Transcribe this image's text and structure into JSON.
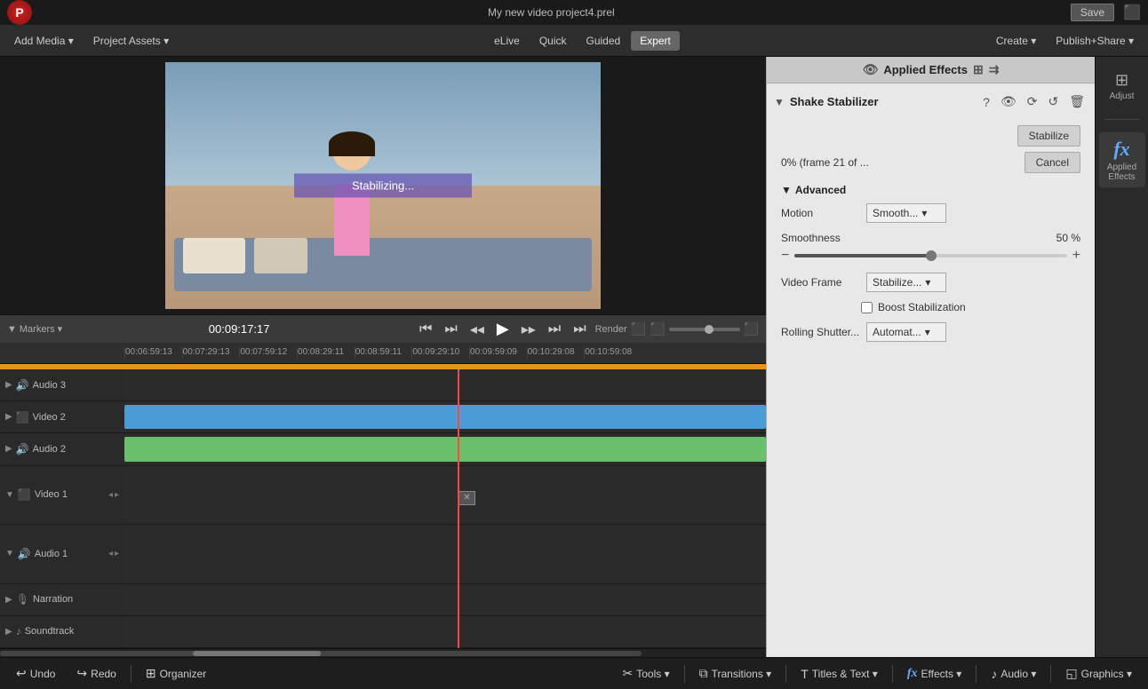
{
  "topbar": {
    "project_name": "My new video project4.prel",
    "save_label": "Save"
  },
  "menubar": {
    "add_media": "Add Media ▾",
    "project_assets": "Project Assets ▾",
    "elive": "eLive",
    "quick": "Quick",
    "guided": "Guided",
    "expert": "Expert",
    "create": "Create ▾",
    "publish_share": "Publish+Share ▾"
  },
  "right_sidebar": {
    "adjust_label": "Adjust",
    "fx_symbol": "fx",
    "effects_label": "Applied\nEffects"
  },
  "effects_panel": {
    "title": "Applied Effects",
    "effect_name": "Shake Stabilizer",
    "stabilize_btn": "Stabilize",
    "cancel_btn": "Cancel",
    "progress_text": "0% (frame 21 of ...",
    "advanced_label": "Advanced",
    "motion_label": "Motion",
    "motion_value": "Smooth...",
    "smoothness_label": "Smoothness",
    "smoothness_value": "50 %",
    "smoothness_percent": 50,
    "video_frame_label": "Video Frame",
    "video_frame_value": "Stabilize...",
    "boost_label": "Boost Stabilization",
    "rolling_shutter_label": "Rolling Shutter...",
    "rolling_shutter_value": "Automat..."
  },
  "preview": {
    "stabilizing_text": "Stabilizing..."
  },
  "markers_bar": {
    "markers_label": "Markers ▾",
    "timecode": "00:09:17:17",
    "render_label": "Render"
  },
  "timeline": {
    "ruler": [
      "00:06:59:13",
      "00:07:29:13",
      "00:07:59:12",
      "00:08:29:11",
      "00:08:59:11",
      "00:09:29:10",
      "00:09:59:09",
      "00:10:29:08",
      "00:10:59:08"
    ],
    "tracks": [
      {
        "name": "Audio 3",
        "type": "audio",
        "has_clip": false
      },
      {
        "name": "Video 2",
        "type": "video",
        "has_clip": true,
        "clip_color": "blue"
      },
      {
        "name": "Audio 2",
        "type": "audio",
        "has_clip": true,
        "clip_color": "green"
      },
      {
        "name": "Video 1",
        "type": "video",
        "has_clip": true,
        "tall": true
      },
      {
        "name": "Audio 1",
        "type": "audio",
        "has_clip": false,
        "tall": true
      },
      {
        "name": "Narration",
        "type": "narration",
        "has_clip": false
      },
      {
        "name": "Soundtrack",
        "type": "soundtrack",
        "has_clip": false
      }
    ]
  },
  "bottom_toolbar": {
    "undo": "Undo",
    "redo": "Redo",
    "organizer": "Organizer",
    "tools": "Tools ▾",
    "transitions": "Transitions ▾",
    "titles_text": "Titles & Text ▾",
    "effects": "Effects ▾",
    "audio": "Audio ▾",
    "graphics": "Graphics ▾"
  }
}
